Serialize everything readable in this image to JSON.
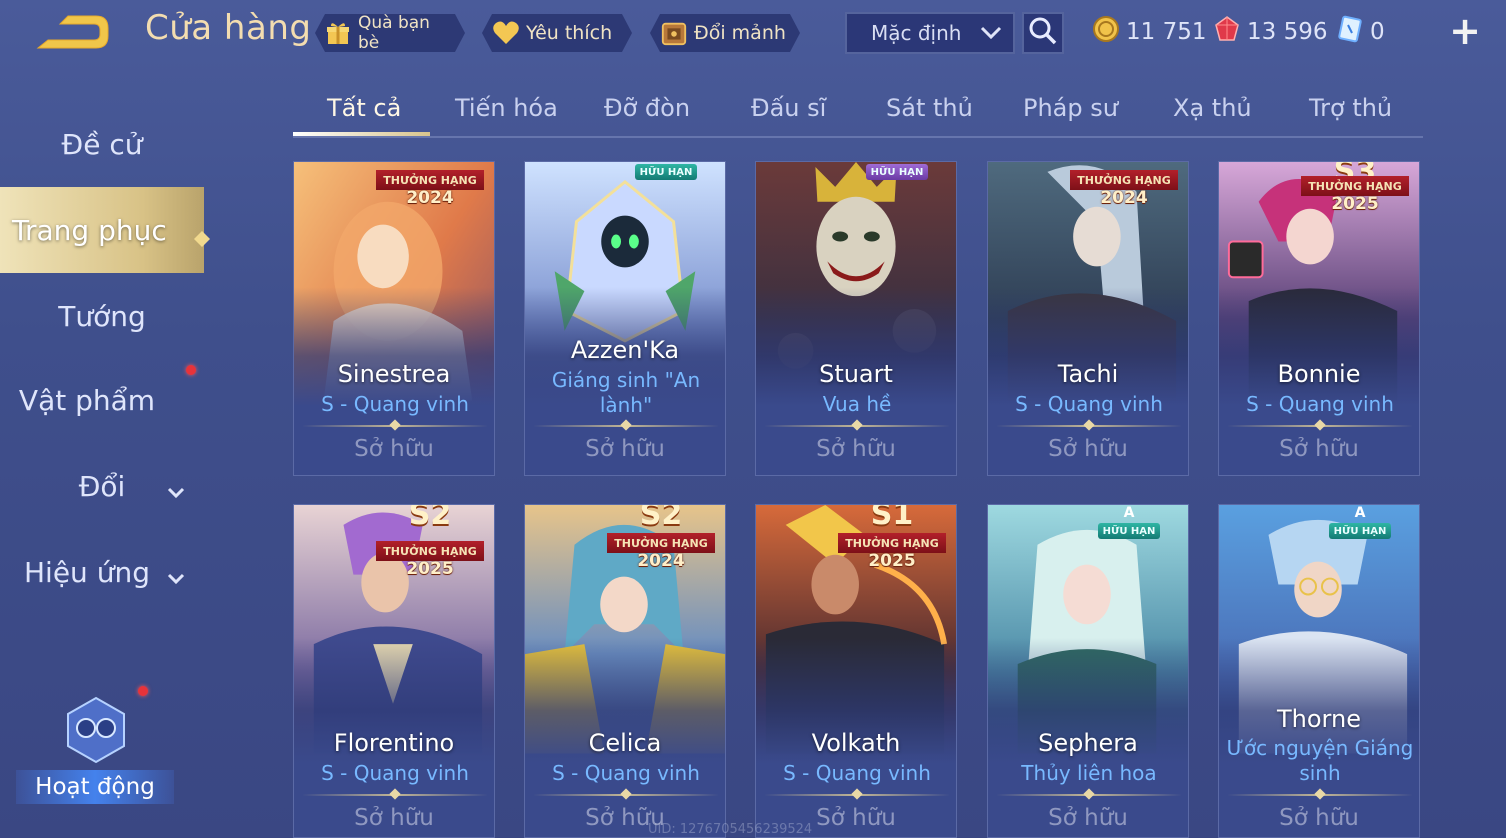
{
  "header": {
    "title": "Cửa hàng",
    "buttons": {
      "gift": "Quà bạn bè",
      "favorite": "Yêu thích",
      "exchange": "Đổi mảnh"
    },
    "sort": {
      "value": "Mặc định"
    },
    "currencies": {
      "gold": "11 751",
      "gems": "13 596",
      "vouchers": "0"
    }
  },
  "sidebar": {
    "items": [
      {
        "label": "Đề cử"
      },
      {
        "label": "Trang phục"
      },
      {
        "label": "Tướng"
      },
      {
        "label": "Vật phẩm"
      },
      {
        "label": "Đổi"
      },
      {
        "label": "Hiệu ứng"
      }
    ],
    "activity": "Hoạt động"
  },
  "tabs": [
    "Tất cả",
    "Tiến hóa",
    "Đỡ đòn",
    "Đấu sĩ",
    "Sát thủ",
    "Pháp sư",
    "Xạ thủ",
    "Trợ thủ"
  ],
  "cards": [
    {
      "name": "Sinestrea",
      "sub": "S - Quang vinh",
      "owned": "Sở hữu",
      "badge_text": "THƯỞNG HẠNG",
      "badge_year": "2024",
      "badge_season": ""
    },
    {
      "name": "Azzen'Ka",
      "sub": "Giáng sinh \"An lành\"",
      "owned": "Sở hữu",
      "limited_text": "HỮU HẠN",
      "limited_rank": ""
    },
    {
      "name": "Stuart",
      "sub": "Vua hề",
      "owned": "Sở hữu",
      "limited_text": "HỮU HẠN",
      "limited_rank": ""
    },
    {
      "name": "Tachi",
      "sub": "S - Quang vinh",
      "owned": "Sở hữu",
      "badge_text": "THƯỞNG HẠNG",
      "badge_year": "2024",
      "badge_season": ""
    },
    {
      "name": "Bonnie",
      "sub": "S - Quang vinh",
      "owned": "Sở hữu",
      "badge_text": "THƯỞNG HẠNG",
      "badge_year": "2025",
      "badge_season": "S3"
    },
    {
      "name": "Florentino",
      "sub": "S - Quang vinh",
      "owned": "Sở hữu",
      "badge_text": "THƯỞNG HẠNG",
      "badge_year": "2025",
      "badge_season": "S2"
    },
    {
      "name": "Celica",
      "sub": "S - Quang vinh",
      "owned": "Sở hữu",
      "badge_text": "THƯỞNG HẠNG",
      "badge_year": "2024",
      "badge_season": "S2"
    },
    {
      "name": "Volkath",
      "sub": "S - Quang vinh",
      "owned": "Sở hữu",
      "badge_text": "THƯỞNG HẠNG",
      "badge_year": "2025",
      "badge_season": "S1"
    },
    {
      "name": "Sephera",
      "sub": "Thủy liên hoa",
      "owned": "Sở hữu",
      "limited_text": "HỮU HẠN",
      "limited_rank": "A"
    },
    {
      "name": "Thorne",
      "sub": "Ước nguyện Giáng sinh",
      "owned": "Sở hữu",
      "limited_text": "HỮU HẠN",
      "limited_rank": "A"
    }
  ],
  "uid": "UID: 1276705456239524",
  "colors": {
    "background": "#4a5b9a",
    "title": "#f3ddb0",
    "subtitle": "#78b9ff",
    "owned": "#8f98c0",
    "active_side": "#d8c286"
  }
}
